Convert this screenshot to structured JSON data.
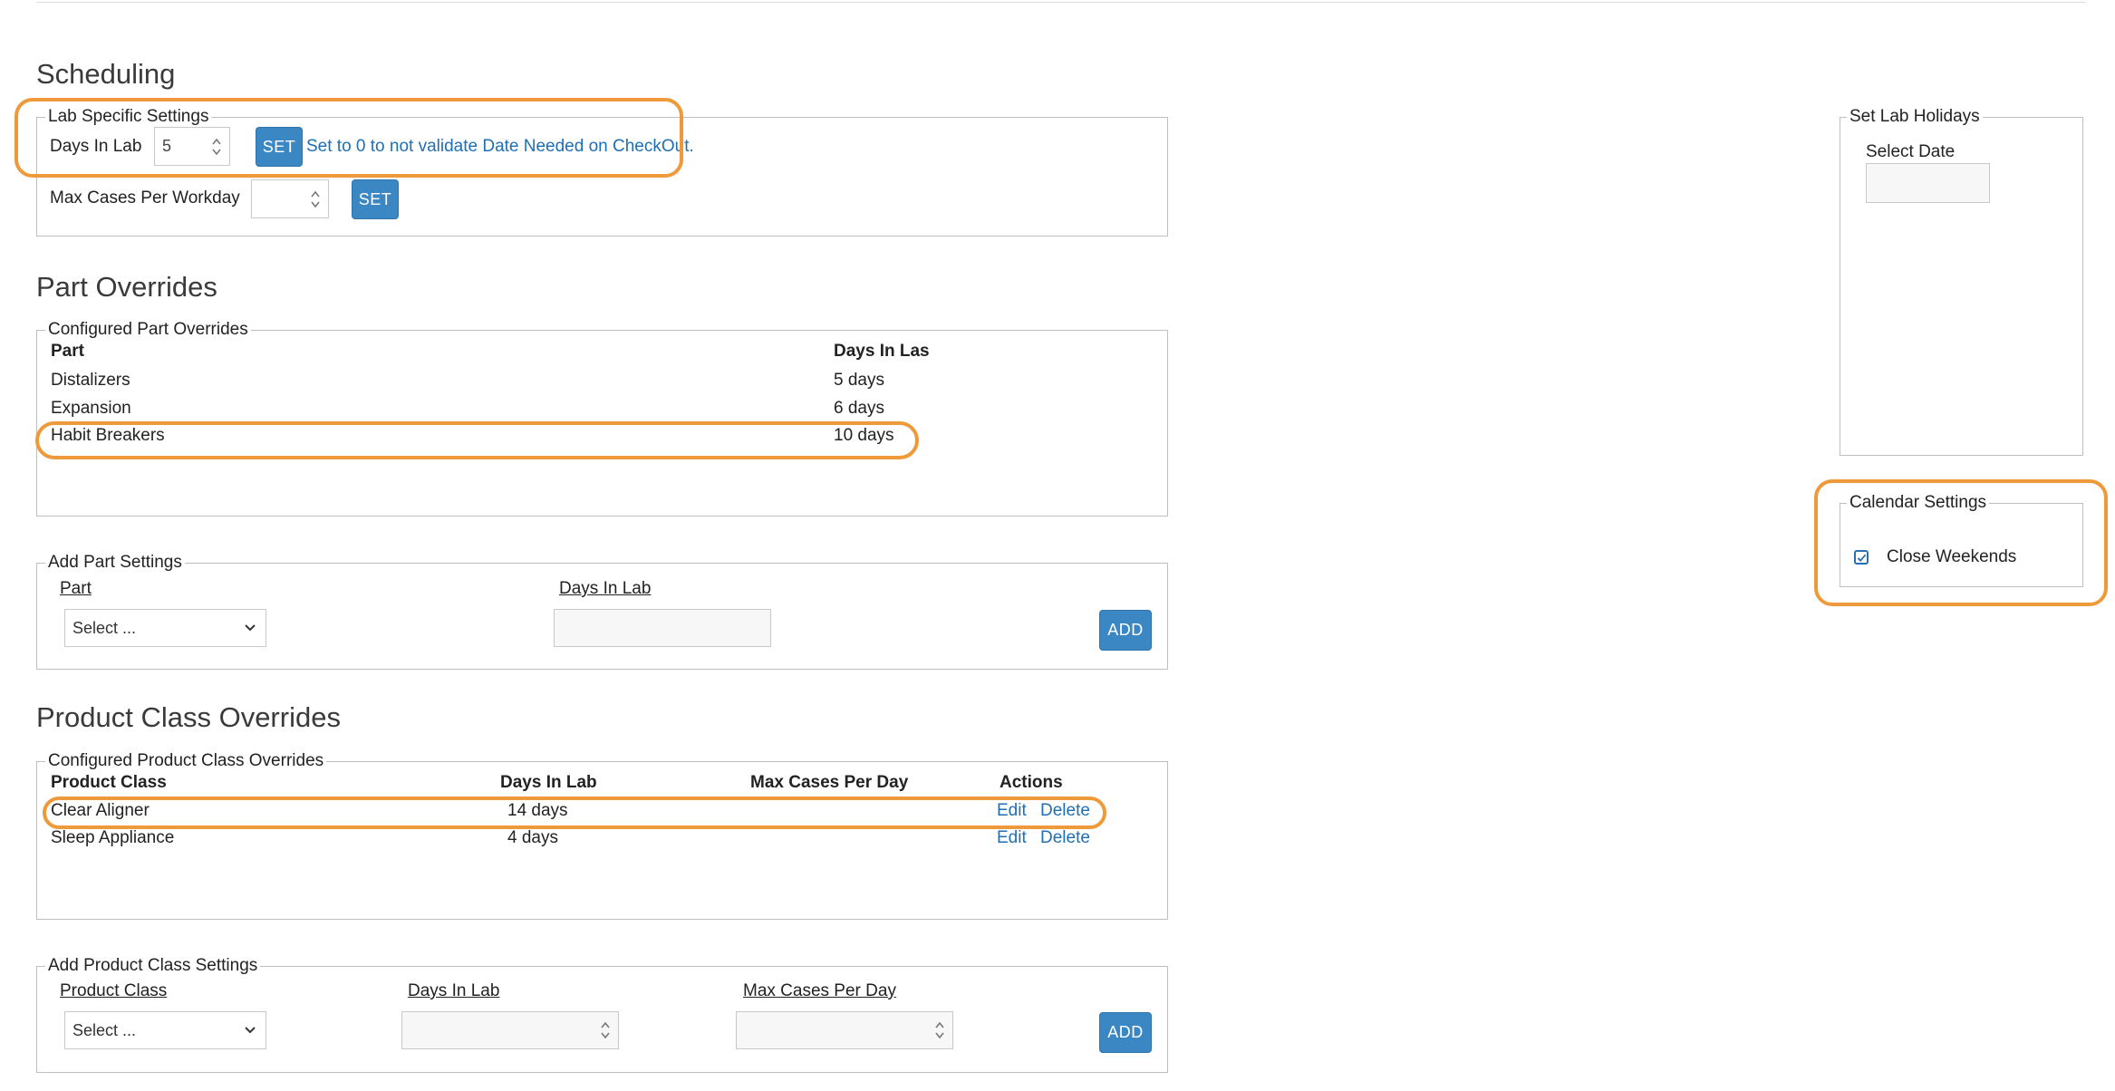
{
  "scheduling": {
    "title": "Scheduling",
    "lab_settings": {
      "legend": "Lab Specific Settings",
      "days_in_lab_label": "Days In Lab",
      "days_in_lab_value": "5",
      "set_label": "SET",
      "hint": "Set to 0 to not validate Date Needed on CheckOut.",
      "max_cases_label": "Max Cases Per Workday",
      "max_cases_value": "",
      "set2_label": "SET"
    }
  },
  "part_overrides": {
    "title": "Part Overrides",
    "configured": {
      "legend": "Configured Part Overrides",
      "headers": {
        "part": "Part",
        "days": "Days In Las"
      },
      "rows": [
        {
          "part": "Distalizers",
          "days": "5 days"
        },
        {
          "part": "Expansion",
          "days": "6 days"
        },
        {
          "part": "Habit Breakers",
          "days": "10 days"
        }
      ]
    },
    "add": {
      "legend": "Add Part Settings",
      "part_label": "Part",
      "days_label": "Days In Lab",
      "select_value": "Select ...",
      "add_label": "ADD"
    }
  },
  "product_class_overrides": {
    "title": "Product Class Overrides",
    "configured": {
      "legend": "Configured Product Class Overrides",
      "headers": {
        "product_class": "Product Class",
        "days": "Days In Lab",
        "max_cases": "Max Cases Per Day",
        "actions": "Actions"
      },
      "rows": [
        {
          "product_class": "Clear Aligner",
          "days": "14 days",
          "max_cases": "",
          "edit": "Edit",
          "delete": "Delete"
        },
        {
          "product_class": "Sleep Appliance",
          "days": "4 days",
          "max_cases": "",
          "edit": "Edit",
          "delete": "Delete"
        }
      ]
    },
    "add": {
      "legend": "Add Product Class Settings",
      "product_class_label": "Product Class",
      "days_label": "Days In Lab",
      "max_cases_label": "Max Cases Per Day",
      "select_value": "Select ...",
      "add_label": "ADD"
    }
  },
  "holidays": {
    "legend": "Set Lab Holidays",
    "select_date_label": "Select Date"
  },
  "calendar": {
    "legend": "Calendar Settings",
    "close_weekends_label": "Close Weekends",
    "close_weekends_checked": true
  },
  "colors": {
    "accent": "#3a87c4",
    "link": "#1f6fb5",
    "highlight": "#ee9a3a"
  }
}
